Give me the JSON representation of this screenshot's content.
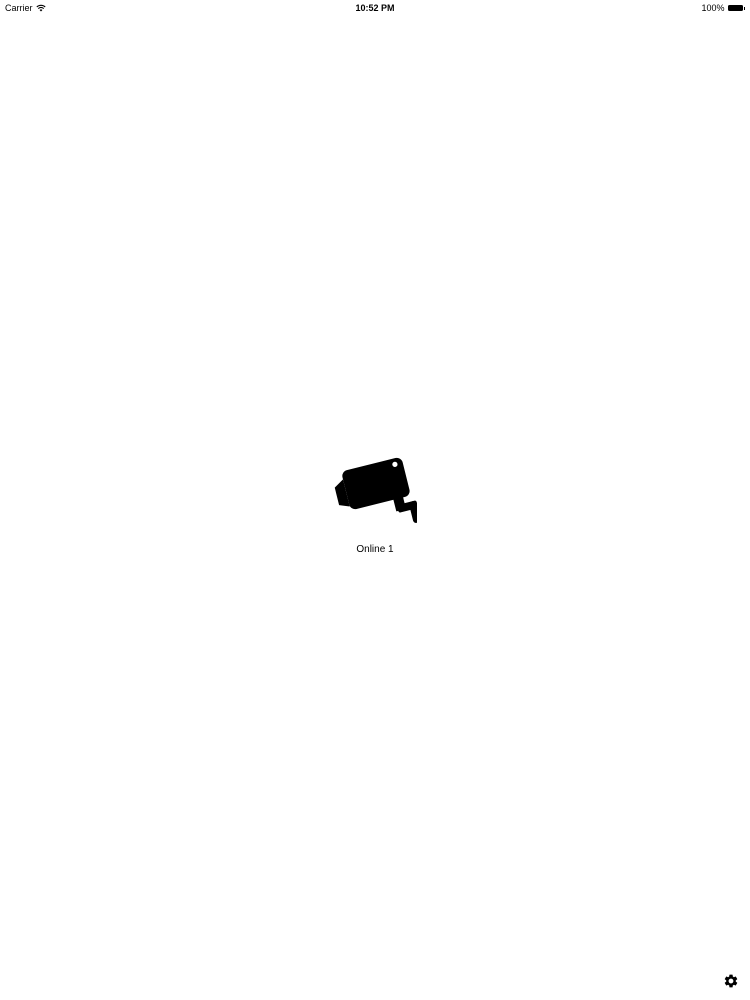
{
  "status_bar": {
    "carrier": "Carrier",
    "time": "10:52 PM",
    "battery_text": "100%",
    "battery_level": 1.0
  },
  "devices": [
    {
      "label": "Online 1",
      "icon": "security-camera-icon"
    }
  ],
  "toolbar": {
    "settings_icon": "gear-icon"
  }
}
